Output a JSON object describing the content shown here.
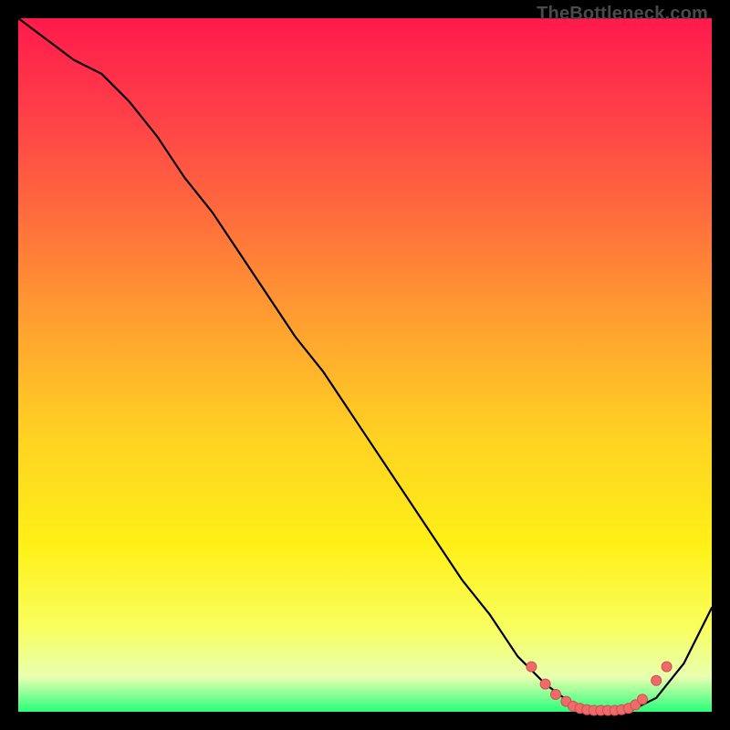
{
  "branding": {
    "watermark": "TheBottleneck.com"
  },
  "chart_data": {
    "type": "line",
    "title": "",
    "xlabel": "",
    "ylabel": "",
    "xlim": [
      0,
      100
    ],
    "ylim": [
      0,
      100
    ],
    "grid": false,
    "legend": false,
    "background": "rainbow_gradient_red_to_green_vertical",
    "series": [
      {
        "name": "bottleneck-curve",
        "x": [
          0,
          4,
          8,
          12,
          16,
          20,
          24,
          28,
          32,
          36,
          40,
          44,
          48,
          52,
          56,
          60,
          64,
          68,
          72,
          76,
          80,
          84,
          88,
          92,
          96,
          100
        ],
        "y": [
          100,
          97,
          94,
          92,
          88,
          83,
          77,
          72,
          66,
          60,
          54,
          49,
          43,
          37,
          31,
          25,
          19,
          14,
          8,
          4,
          1,
          0,
          0,
          2,
          7,
          15
        ]
      }
    ],
    "markers": [
      {
        "name": "optimal-band-dots",
        "x": [
          74,
          76,
          77.5,
          79,
          80,
          81,
          82,
          83,
          84,
          85,
          86,
          87,
          88,
          89,
          90,
          92,
          93.5
        ],
        "y": [
          6.5,
          4,
          2.5,
          1.5,
          0.8,
          0.5,
          0.3,
          0.2,
          0.2,
          0.2,
          0.2,
          0.3,
          0.5,
          1,
          1.8,
          4.5,
          6.5
        ],
        "style": "salmon-dot"
      }
    ]
  },
  "colors": {
    "curve": "#000000",
    "dots": "#ef6b6b"
  }
}
